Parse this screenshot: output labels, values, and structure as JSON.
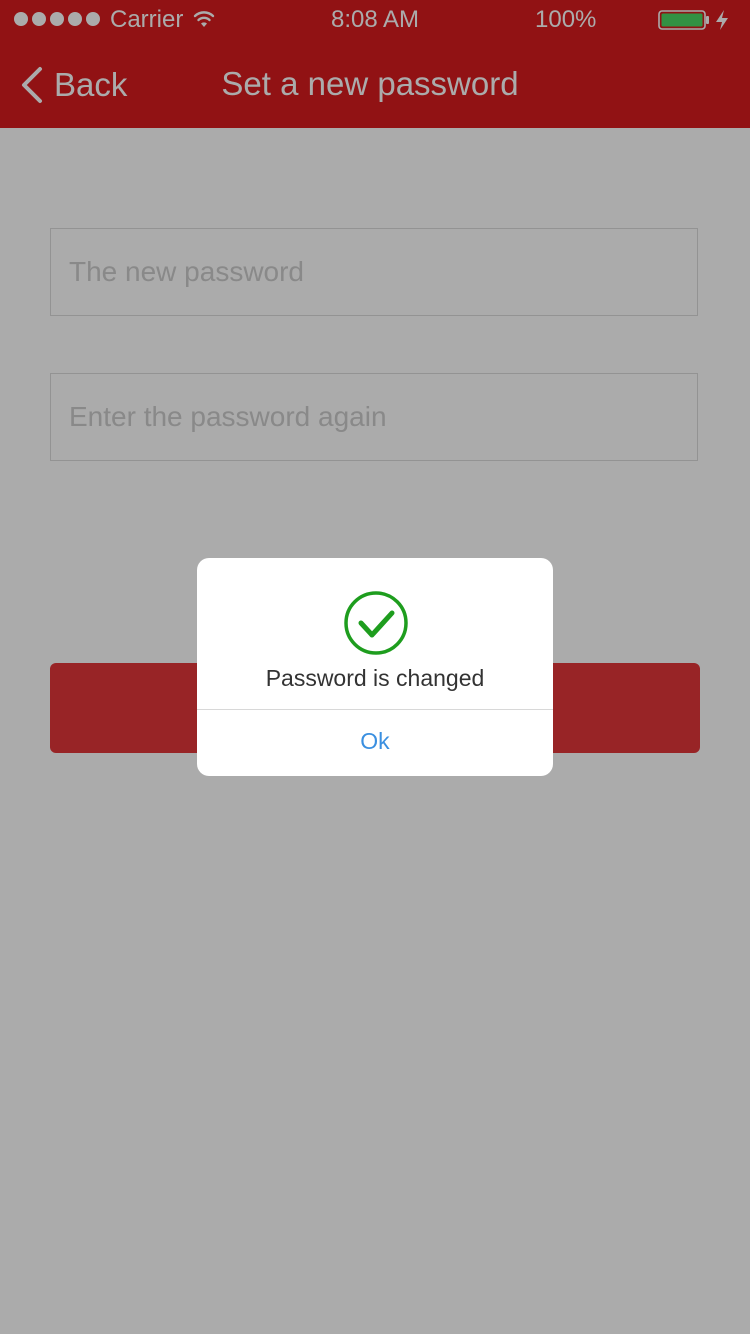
{
  "status_bar": {
    "carrier": "Carrier",
    "time": "8:08 AM",
    "battery": "100%"
  },
  "nav": {
    "back_label": "Back",
    "title": "Set a new password"
  },
  "form": {
    "new_password_placeholder": "The new password",
    "confirm_password_placeholder": "Enter the password again"
  },
  "dialog": {
    "message": "Password is changed",
    "ok_label": "Ok"
  },
  "colors": {
    "header": "#d81c1f",
    "button": "#e3373a",
    "success": "#1e9d1e",
    "link": "#3a8fe0"
  }
}
